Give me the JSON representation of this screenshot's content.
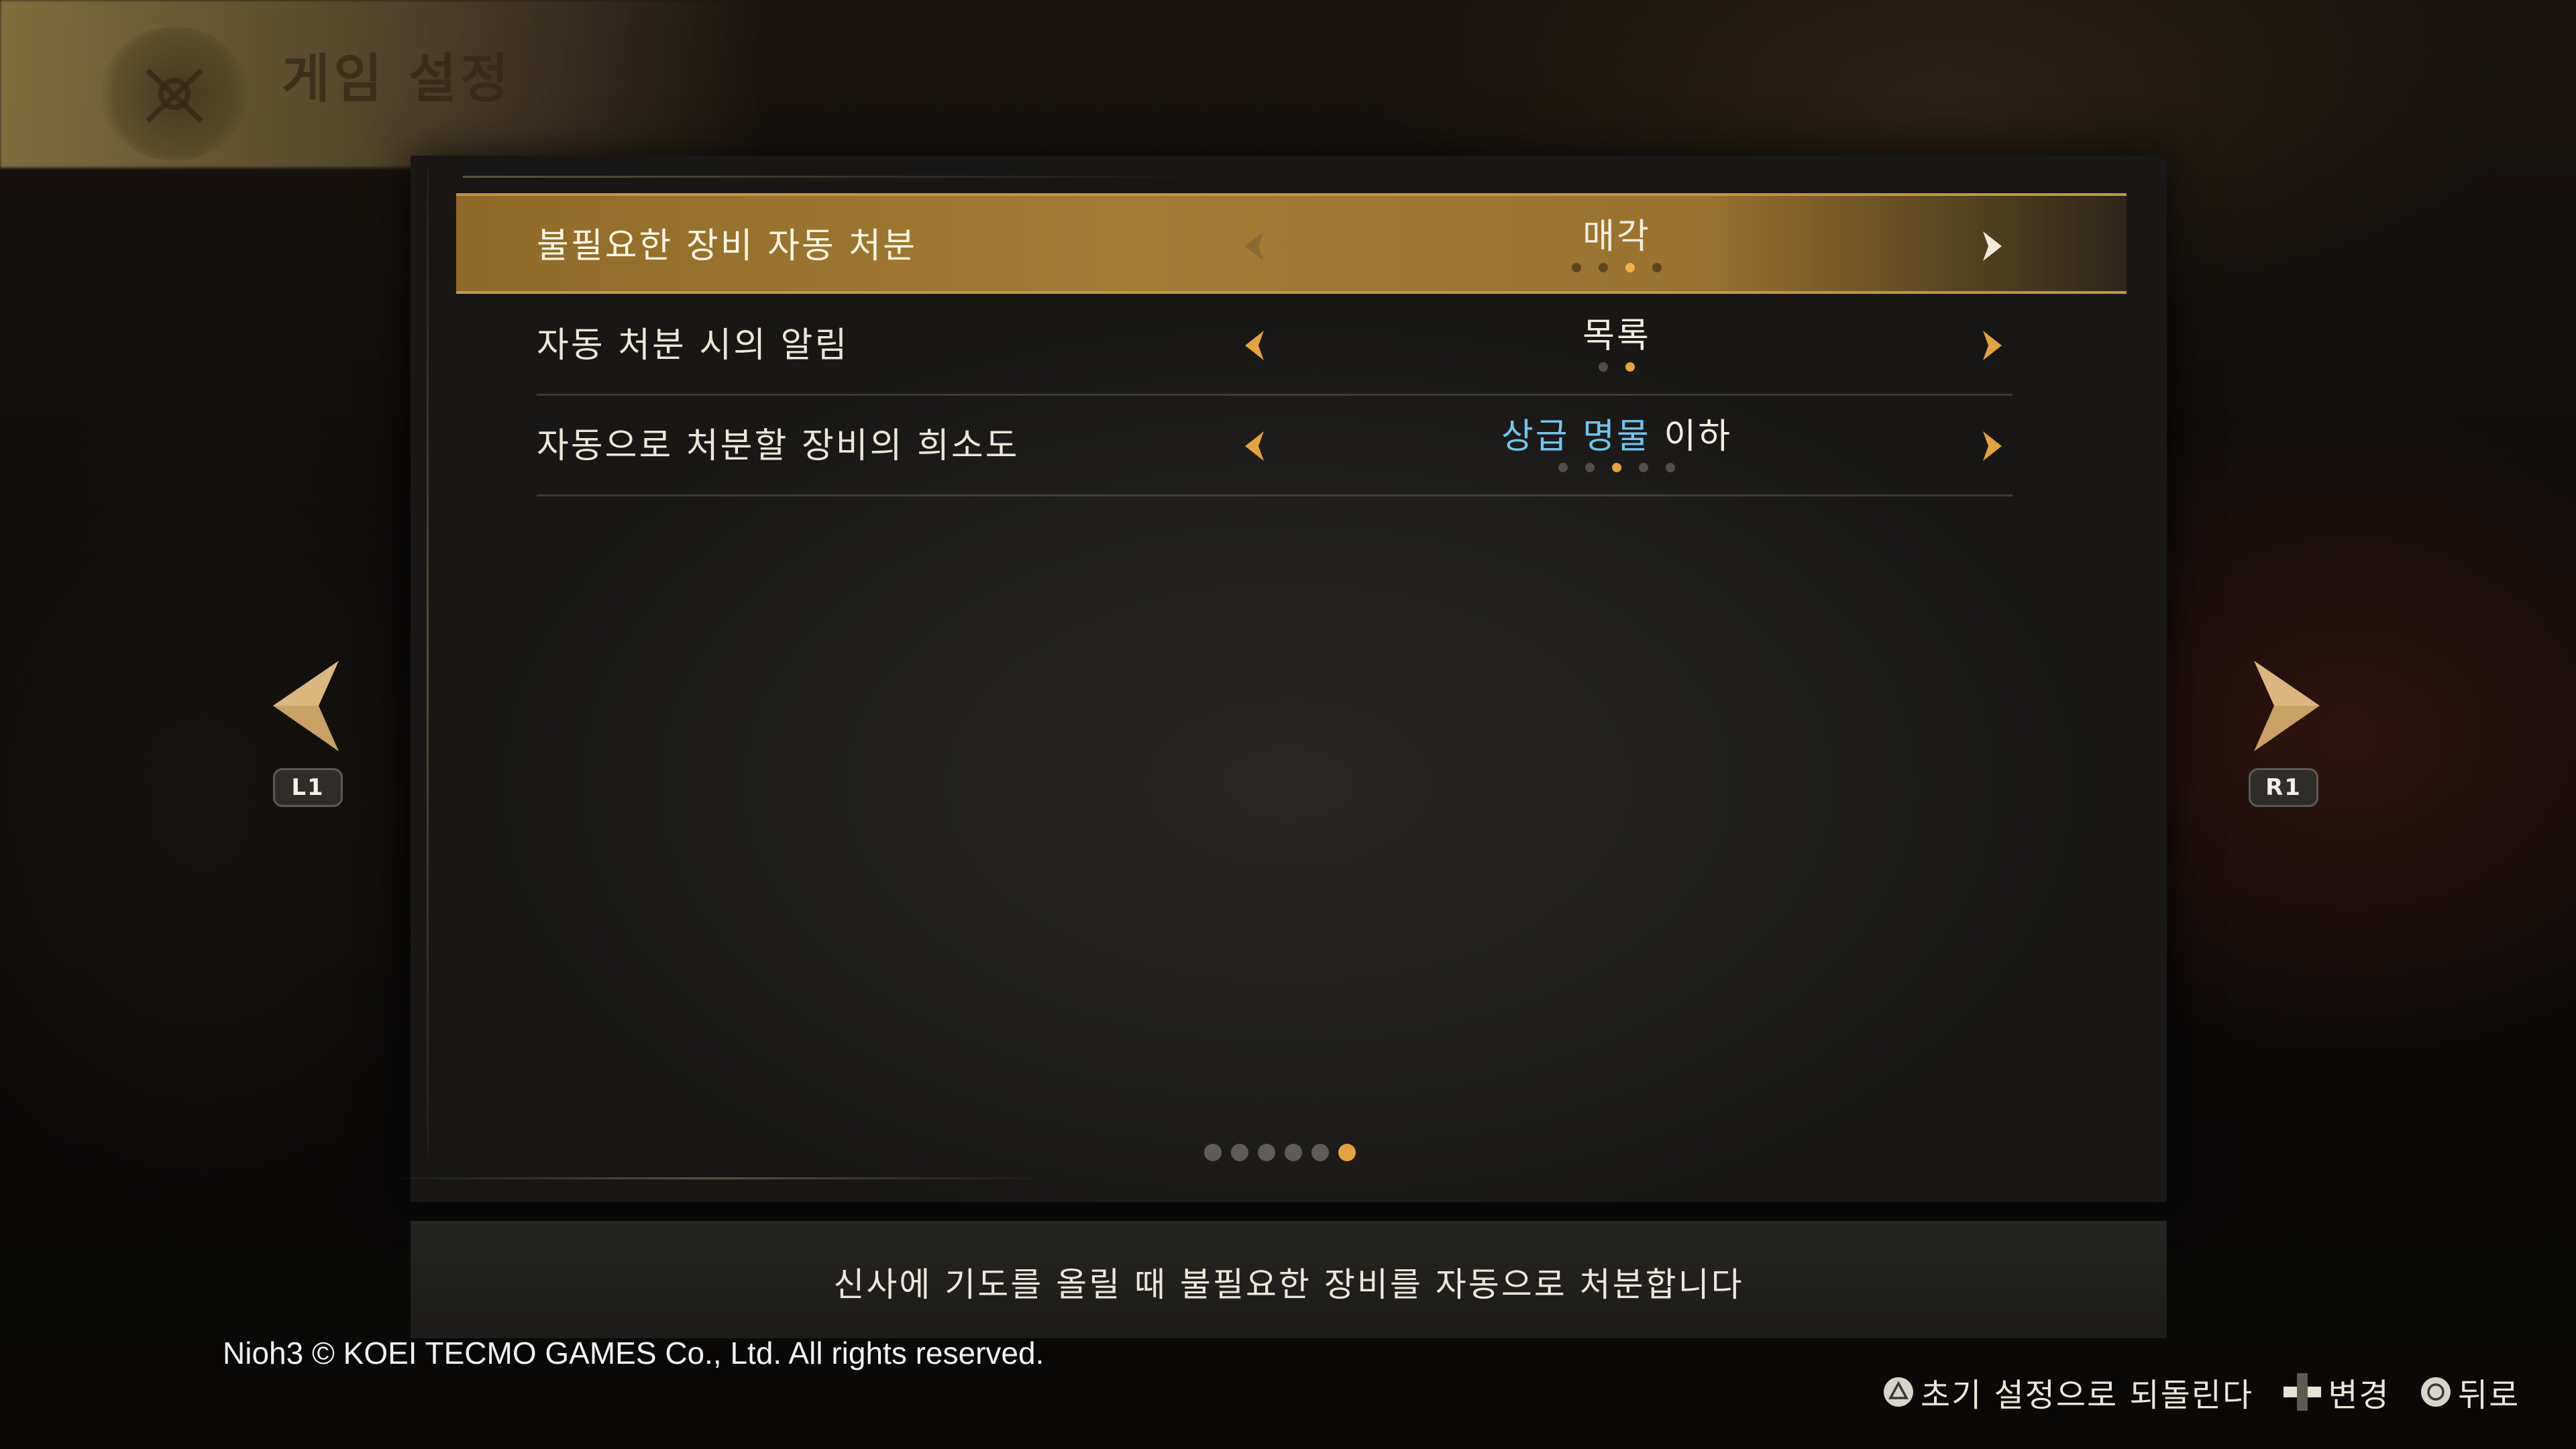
{
  "header": {
    "title": "게임 설정"
  },
  "settings": [
    {
      "label": "불필요한 장비 자동 처분",
      "value": "매각",
      "value_highlight": "",
      "dots": [
        0,
        0,
        1,
        0
      ],
      "selected": true
    },
    {
      "label": "자동 처분 시의 알림",
      "value": "목록",
      "value_highlight": "",
      "dots": [
        0,
        1
      ],
      "selected": false
    },
    {
      "label": "자동으로 처분할 장비의 희소도",
      "value": " 이하",
      "value_highlight": "상급 명물",
      "dots": [
        0,
        0,
        1,
        0,
        0
      ],
      "selected": false
    }
  ],
  "page_indicator": {
    "total": 6,
    "current": 6
  },
  "nav": {
    "left_button": "L1",
    "right_button": "R1"
  },
  "description": "신사에 기도를 올릴 때 불필요한 장비를 자동으로 처분합니다",
  "copyright": "Nioh3 © KOEI TECMO GAMES Co., Ltd. All rights reserved.",
  "button_guide": [
    {
      "icon": "triangle-button-icon",
      "label": "초기 설정으로 되돌린다"
    },
    {
      "icon": "dpad-icon",
      "label": "변경"
    },
    {
      "icon": "circle-button-icon",
      "label": "뒤로"
    }
  ],
  "colors": {
    "accent": "#e6a33c",
    "highlight_text": "#6fc6f0",
    "selected_row": "#b4873a"
  }
}
